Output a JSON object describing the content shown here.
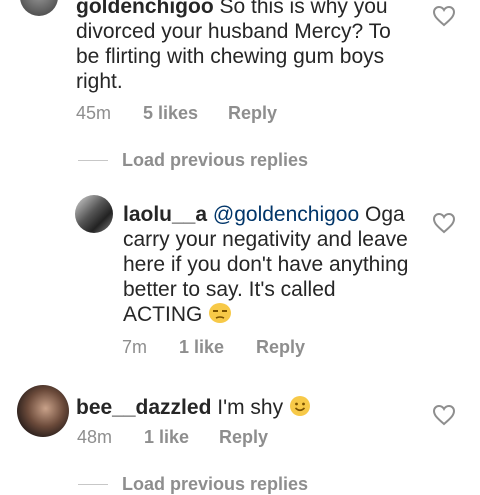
{
  "comment1": {
    "username": "goldenchigoo",
    "text_lines": [
      "So this is why you",
      "divorced your husband Mercy? To",
      "be flirting with chewing gum boys",
      "right."
    ],
    "time": "45m",
    "likes": "5 likes",
    "reply": "Reply"
  },
  "load1": {
    "label": "Load previous replies"
  },
  "reply1": {
    "username": "laolu__a",
    "mention": "@goldenchigoo",
    "text_lines": [
      "Oga",
      "carry your negativity and leave",
      "here if you don't have anything",
      "better to say. It's called",
      "ACTING"
    ],
    "emoji": "unamused-face-icon",
    "time": "7m",
    "likes": "1 like",
    "reply": "Reply"
  },
  "comment2": {
    "username": "bee__dazzled",
    "text": "I'm shy",
    "emoji": "smiling-face-icon",
    "time": "48m",
    "likes": "1 like",
    "reply": "Reply"
  },
  "load2": {
    "label": "Load previous replies"
  },
  "colors": {
    "text": "#262626",
    "muted": "#8e8e8e",
    "mention": "#003569"
  }
}
